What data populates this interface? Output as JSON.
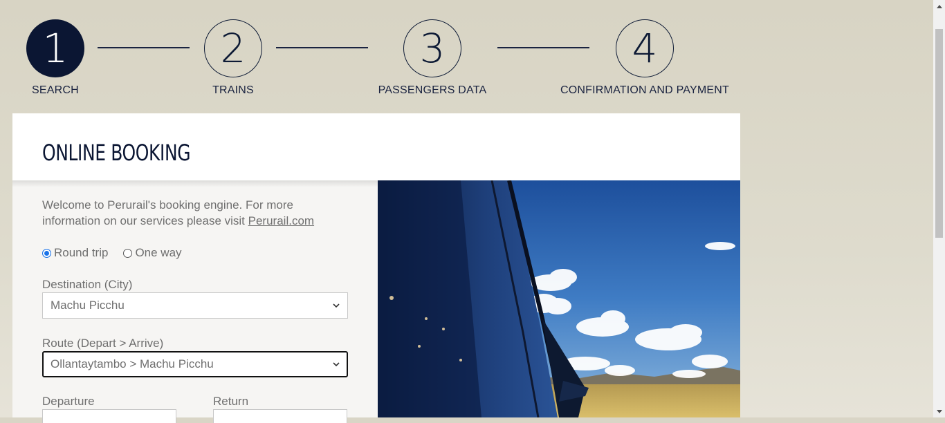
{
  "stepper": {
    "steps": [
      {
        "number": "1",
        "label": "SEARCH",
        "active": true
      },
      {
        "number": "2",
        "label": "TRAINS",
        "active": false
      },
      {
        "number": "3",
        "label": "PASSENGERS DATA",
        "active": false
      },
      {
        "number": "4",
        "label": "CONFIRMATION AND PAYMENT",
        "active": false
      }
    ]
  },
  "booking": {
    "title": "ONLINE BOOKING",
    "intro_text": "Welcome to Perurail's booking engine. For more information on our services please visit ",
    "intro_link": "Perurail.com",
    "trip_types": {
      "round_trip": "Round trip",
      "one_way": "One way",
      "selected": "round_trip"
    },
    "destination": {
      "label": "Destination (City)",
      "value": "Machu Picchu"
    },
    "route": {
      "label": "Route (Depart > Arrive)",
      "value": "Ollantaytambo > Machu Picchu"
    },
    "departure": {
      "label": "Departure"
    },
    "return": {
      "label": "Return"
    }
  },
  "colors": {
    "page_bg": "#d9d5c6",
    "navy": "#0b1633",
    "body_text": "#6f6f6f"
  },
  "icons": [
    "chevron-down-icon",
    "radio-icon",
    "scroll-up-icon",
    "scroll-down-icon"
  ]
}
